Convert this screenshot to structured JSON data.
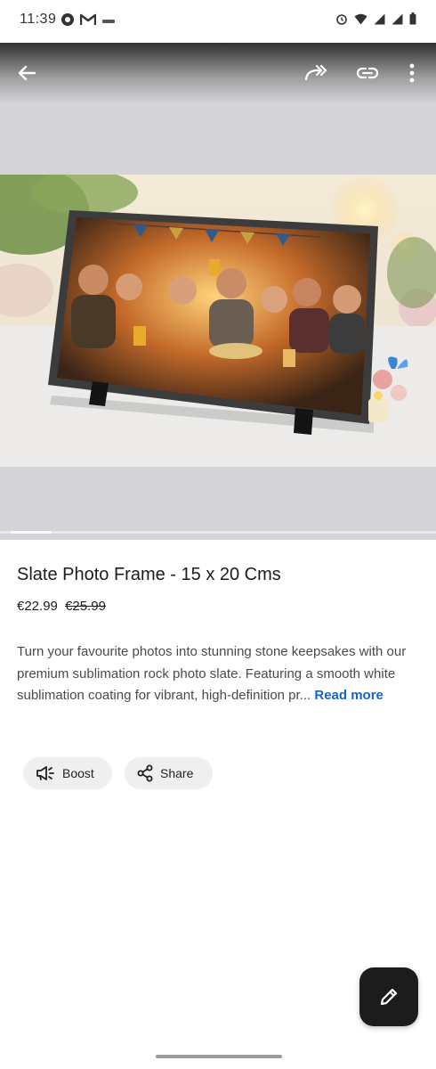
{
  "status_bar": {
    "time": "11:39",
    "left_icons": [
      "sync-icon",
      "gmail-icon",
      "notification-icon"
    ],
    "right_icons": [
      "alarm-icon",
      "wifi-icon",
      "signal-icon",
      "signal-r-icon",
      "battery-icon"
    ]
  },
  "app_bar": {
    "icons": [
      "back-arrow-icon",
      "forward-share-icon",
      "link-icon",
      "more-vert-icon"
    ]
  },
  "media": {
    "image_subject": "slate photo frame with group photo",
    "carousel_position": 1
  },
  "product": {
    "title": "Slate Photo Frame - 15 x 20 Cms",
    "price_current": "€22.99",
    "price_original": "€25.99",
    "description": "Turn your favourite photos into stunning stone keepsakes with our premium sublimation rock photo slate. Featuring a smooth white sublimation coating for vibrant, high-definition pr...",
    "read_more": "Read more"
  },
  "actions": {
    "boost_label": "Boost",
    "share_label": "Share"
  },
  "fab": {
    "icon": "edit-pencil-icon"
  },
  "colors": {
    "accent": "#1565c0",
    "fab_background": "#1c1c1c",
    "chip_background": "#efefef",
    "media_background": "#d4d4d8"
  }
}
